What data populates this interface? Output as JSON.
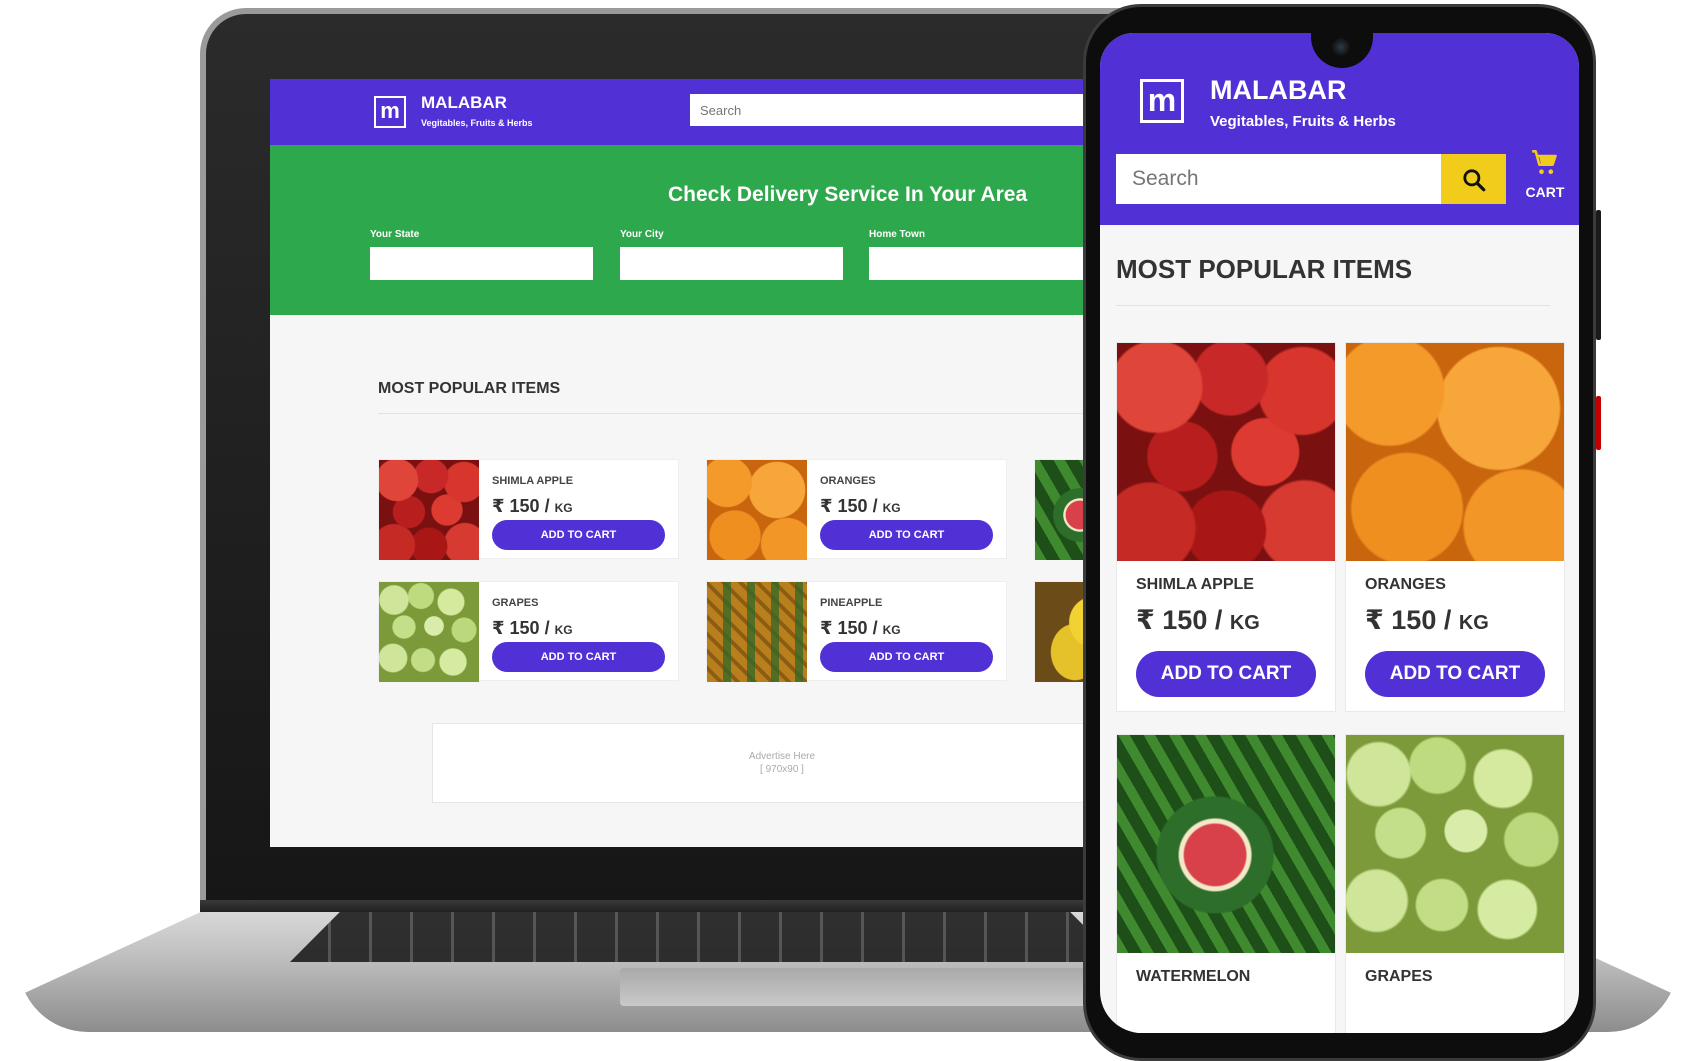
{
  "laptop": {
    "header": {
      "logo_letter": "m",
      "brand": "MALABAR",
      "tagline": "Vegitables, Fruits & Herbs",
      "search_placeholder": "Search"
    },
    "delivery": {
      "title": "Check Delivery Service In Your Area",
      "fields": [
        {
          "label": "Your State"
        },
        {
          "label": "Your City"
        },
        {
          "label": "Home Town"
        }
      ]
    },
    "section_title": "MOST POPULAR ITEMS",
    "products": [
      {
        "name": "SHIMLA APPLE",
        "price": "₹ 150",
        "unit": "KG",
        "button": "ADD TO CART",
        "image": "apple"
      },
      {
        "name": "ORANGES",
        "price": "₹ 150",
        "unit": "KG",
        "button": "ADD TO CART",
        "image": "orange"
      },
      {
        "name": "GRAPES",
        "price": "₹ 150",
        "unit": "KG",
        "button": "ADD TO CART",
        "image": "grape"
      },
      {
        "name": "PINEAPPLE",
        "price": "₹ 150",
        "unit": "KG",
        "button": "ADD TO CART",
        "image": "pineapple"
      }
    ],
    "ad": {
      "line1": "Advertise Here",
      "line2": "[ 970x90 ]"
    }
  },
  "phone": {
    "header": {
      "logo_letter": "m",
      "brand": "MALABAR",
      "tagline": "Vegitables, Fruits & Herbs",
      "search_placeholder": "Search",
      "search_icon": "search-icon",
      "cart_icon": "cart-icon",
      "cart_label": "CART"
    },
    "section_title": "MOST POPULAR ITEMS",
    "products": [
      {
        "name": "SHIMLA APPLE",
        "price": "₹ 150",
        "unit": "KG",
        "button": "ADD TO CART",
        "image": "apple"
      },
      {
        "name": "ORANGES",
        "price": "₹ 150",
        "unit": "KG",
        "button": "ADD TO CART",
        "image": "orange"
      },
      {
        "name": "WATERMELON",
        "image": "watermelon"
      },
      {
        "name": "GRAPES",
        "image": "grape"
      }
    ]
  },
  "colors": {
    "brand_purple": "#5130d6",
    "delivery_green": "#2ea84c",
    "search_yellow": "#f1cc1b"
  }
}
